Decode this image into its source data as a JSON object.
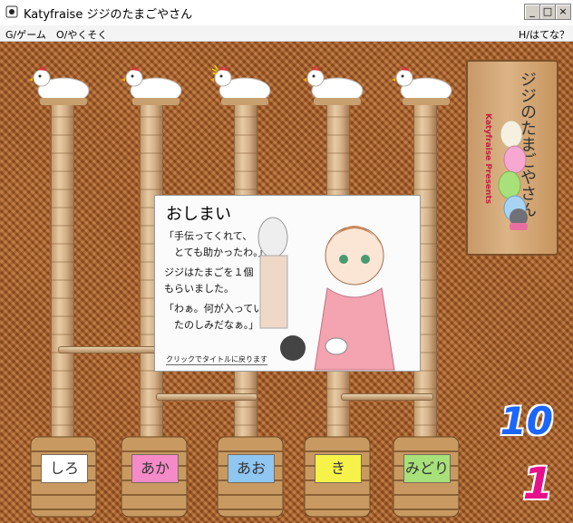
{
  "window": {
    "title": "Katyfraise ジジのたまごやさん",
    "buttons": {
      "minimize": "_",
      "maximize": "□",
      "close": "×"
    }
  },
  "menu": {
    "game": "G/ゲーム",
    "rules": "O/やくそく",
    "help": "H/はてな？"
  },
  "sign": {
    "presents": "Katyfraise Presents",
    "title": "ジジのたまごやさん"
  },
  "popup": {
    "title": "おしまい",
    "lines": [
      "「手伝ってくれて、",
      "　とても助かったわ。」",
      "ジジはたまごを１個",
      "もらいました。",
      "「わぁ。何が入っているか",
      "　たのしみだなぁ。」"
    ],
    "hint": "クリックでタイトルに戻ります"
  },
  "baskets": [
    {
      "label": "しろ",
      "color": "#ffffff"
    },
    {
      "label": "あか",
      "color": "#f58ac8"
    },
    {
      "label": "あお",
      "color": "#8fc6f2"
    },
    {
      "label": "き",
      "color": "#f6f24a"
    },
    {
      "label": "みどり",
      "color": "#a8e07a"
    }
  ],
  "scores": {
    "top": "10",
    "top_color": "#1a66ff",
    "bottom": "1",
    "bottom_color": "#e8108a"
  }
}
